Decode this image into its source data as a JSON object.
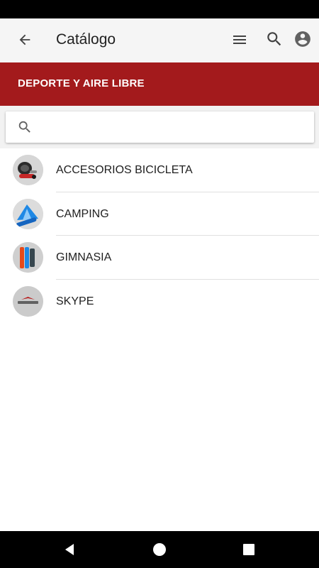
{
  "app_bar": {
    "title": "Catálogo",
    "icons": [
      "back-arrow-icon",
      "menu-icon",
      "search-icon",
      "account-icon"
    ]
  },
  "banner": {
    "label": "DEPORTE Y AIRE LIBRE",
    "color": "#a31a1c"
  },
  "search": {
    "placeholder": "",
    "value": ""
  },
  "list": {
    "items": [
      {
        "label": "ACCESORIOS BICICLETA",
        "thumb": "bicycle-accessories-thumbnail"
      },
      {
        "label": "CAMPING",
        "thumb": "camping-tent-thumbnail"
      },
      {
        "label": "GIMNASIA",
        "thumb": "gym-mats-thumbnail"
      },
      {
        "label": "SKYPE",
        "thumb": "skype-logo-thumbnail"
      }
    ]
  },
  "nav": {
    "icons": [
      "nav-back-icon",
      "nav-home-icon",
      "nav-recents-icon"
    ]
  }
}
